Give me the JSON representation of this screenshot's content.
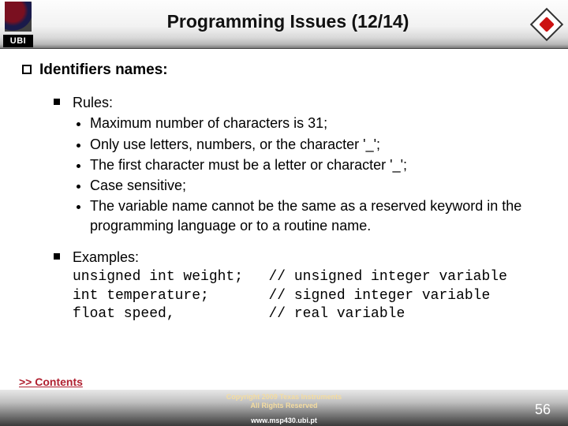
{
  "header": {
    "title": "Programming Issues (12/14)",
    "ubi": "UBI"
  },
  "main": {
    "section_heading": "Identifiers names:",
    "rules": {
      "label": "Rules:",
      "items": [
        "Maximum number of characters is 31;",
        "Only use letters, numbers, or the character '_';",
        "The first character must be a letter or character '_';",
        "Case sensitive;",
        "The variable name cannot be the same as a reserved keyword in the programming language or to a routine name."
      ]
    },
    "examples": {
      "label": "Examples:",
      "code": "unsigned int weight;   // unsigned integer variable\nint temperature;       // signed integer variable\nfloat speed,           // real variable"
    }
  },
  "footer": {
    "contents_link": ">> Contents",
    "copyright_line1": "Copyright 2009 Texas Instruments",
    "copyright_line2": "All Rights Reserved",
    "url": "www.msp430.ubi.pt",
    "page_number": "56"
  }
}
